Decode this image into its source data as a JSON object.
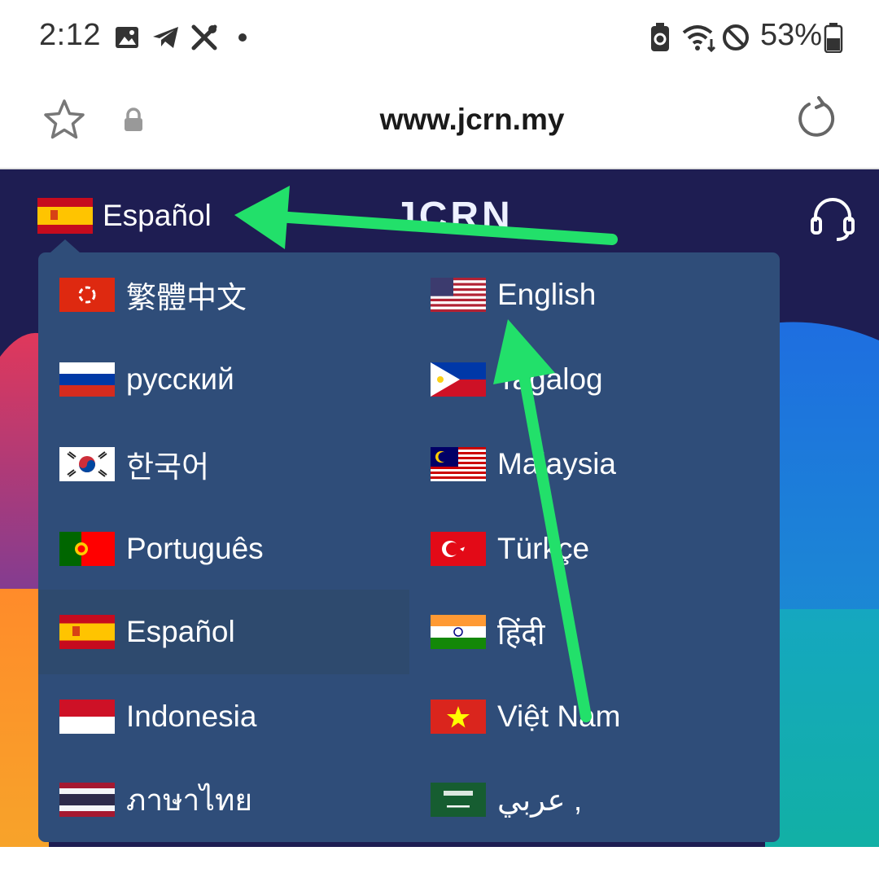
{
  "status_bar": {
    "time": "2:12",
    "battery": "53%",
    "icons": [
      "gallery-icon",
      "telegram-icon",
      "tools-icon",
      "dot-icon",
      "battery-saver-icon",
      "wifi-icon",
      "do-not-disturb-icon",
      "battery-icon"
    ]
  },
  "browser": {
    "url": "www.jcrn.my"
  },
  "header": {
    "brand": "JCRN",
    "current_language": "Español"
  },
  "languages": {
    "left": [
      {
        "label": "繁體中文",
        "flag": "hong-kong"
      },
      {
        "label": "русский",
        "flag": "russia"
      },
      {
        "label": "한국어",
        "flag": "south-korea"
      },
      {
        "label": "Português",
        "flag": "portugal"
      },
      {
        "label": "Español",
        "flag": "spain",
        "selected": true
      },
      {
        "label": "Indonesia",
        "flag": "indonesia"
      },
      {
        "label": "ภาษาไทย",
        "flag": "thailand"
      }
    ],
    "right": [
      {
        "label": "English",
        "flag": "usa"
      },
      {
        "label": "Tagalog",
        "flag": "philippines"
      },
      {
        "label": "Malaysia",
        "flag": "malaysia"
      },
      {
        "label": "Türkçe",
        "flag": "turkey"
      },
      {
        "label": "हिंदी",
        "flag": "india"
      },
      {
        "label": "Việt Nam",
        "flag": "vietnam"
      },
      {
        "label": "عربي ,",
        "flag": "saudi-arabia"
      }
    ]
  },
  "colors": {
    "dropdown_bg": "#2f4d79",
    "selected_bg": "#2e4a6e",
    "header_bg": "#1e1d52",
    "annotation_arrow": "#22e06a"
  }
}
